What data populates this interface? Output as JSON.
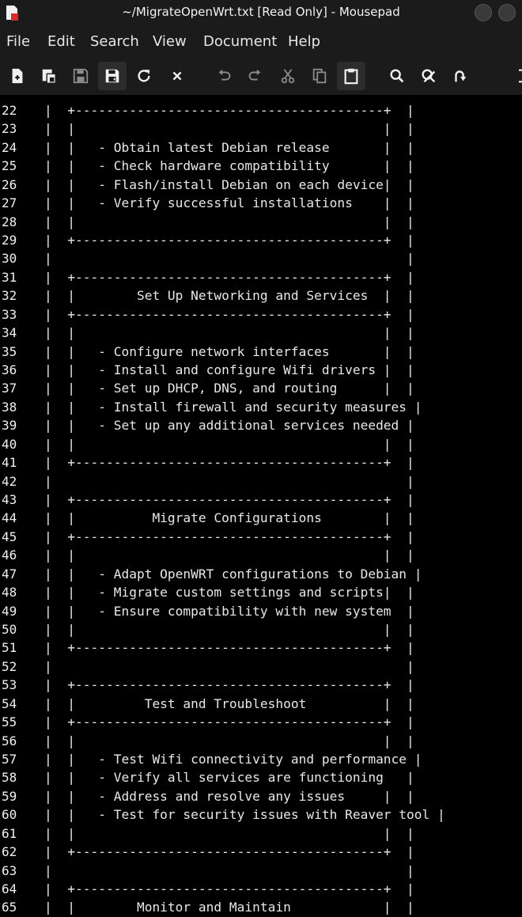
{
  "window": {
    "title": "~/MigrateOpenWrt.txt [Read Only] - Mousepad"
  },
  "menu": [
    {
      "label": "File"
    },
    {
      "label": "Edit"
    },
    {
      "label": "Search"
    },
    {
      "label": "View"
    },
    {
      "label": "Document"
    },
    {
      "label": "Help"
    }
  ],
  "toolbar": [
    {
      "icon": "new-document-icon"
    },
    {
      "icon": "new-window-icon"
    },
    {
      "icon": "save-icon"
    },
    {
      "icon": "save-as-icon"
    },
    {
      "icon": "reload-icon"
    },
    {
      "icon": "close-tab-icon"
    },
    {
      "icon": "undo-icon"
    },
    {
      "icon": "redo-icon"
    },
    {
      "icon": "cut-icon"
    },
    {
      "icon": "copy-icon"
    },
    {
      "icon": "paste-icon"
    },
    {
      "icon": "find-icon"
    },
    {
      "icon": "find-replace-icon"
    },
    {
      "icon": "go-to-line-icon"
    },
    {
      "icon": "fullscreen-icon"
    }
  ],
  "editor": {
    "lines": [
      {
        "num": "22",
        "text": "|  +----------------------------------------+  |"
      },
      {
        "num": "23",
        "text": "|  |                                        |  |"
      },
      {
        "num": "24",
        "text": "|  |   - Obtain latest Debian release       |  |"
      },
      {
        "num": "25",
        "text": "|  |   - Check hardware compatibility       |  |"
      },
      {
        "num": "26",
        "text": "|  |   - Flash/install Debian on each device|  |"
      },
      {
        "num": "27",
        "text": "|  |   - Verify successful installations    |  |"
      },
      {
        "num": "28",
        "text": "|  |                                        |  |"
      },
      {
        "num": "29",
        "text": "|  +----------------------------------------+  |"
      },
      {
        "num": "30",
        "text": "|                                              |"
      },
      {
        "num": "31",
        "text": "|  +----------------------------------------+  |"
      },
      {
        "num": "32",
        "text": "|  |        Set Up Networking and Services  |  |"
      },
      {
        "num": "33",
        "text": "|  +----------------------------------------+  |"
      },
      {
        "num": "34",
        "text": "|  |                                        |  |"
      },
      {
        "num": "35",
        "text": "|  |   - Configure network interfaces       |  |"
      },
      {
        "num": "36",
        "text": "|  |   - Install and configure Wifi drivers |  |"
      },
      {
        "num": "37",
        "text": "|  |   - Set up DHCP, DNS, and routing      |  |"
      },
      {
        "num": "38",
        "text": "|  |   - Install firewall and security measures |"
      },
      {
        "num": "39",
        "text": "|  |   - Set up any additional services needed |"
      },
      {
        "num": "40",
        "text": "|  |                                        |  |"
      },
      {
        "num": "41",
        "text": "|  +----------------------------------------+  |"
      },
      {
        "num": "42",
        "text": "|                                              |"
      },
      {
        "num": "43",
        "text": "|  +----------------------------------------+  |"
      },
      {
        "num": "44",
        "text": "|  |          Migrate Configurations        |  |"
      },
      {
        "num": "45",
        "text": "|  +----------------------------------------+  |"
      },
      {
        "num": "46",
        "text": "|  |                                        |  |"
      },
      {
        "num": "47",
        "text": "|  |   - Adapt OpenWRT configurations to Debian |"
      },
      {
        "num": "48",
        "text": "|  |   - Migrate custom settings and scripts|  |"
      },
      {
        "num": "49",
        "text": "|  |   - Ensure compatibility with new system  |"
      },
      {
        "num": "50",
        "text": "|  |                                        |  |"
      },
      {
        "num": "51",
        "text": "|  +----------------------------------------+  |"
      },
      {
        "num": "52",
        "text": "|                                              |"
      },
      {
        "num": "53",
        "text": "|  +----------------------------------------+  |"
      },
      {
        "num": "54",
        "text": "|  |         Test and Troubleshoot          |  |"
      },
      {
        "num": "55",
        "text": "|  +----------------------------------------+  |"
      },
      {
        "num": "56",
        "text": "|  |                                        |  |"
      },
      {
        "num": "57",
        "text": "|  |   - Test Wifi connectivity and performance |"
      },
      {
        "num": "58",
        "text": "|  |   - Verify all services are functioning   |"
      },
      {
        "num": "59",
        "text": "|  |   - Address and resolve any issues     |  |"
      },
      {
        "num": "60",
        "text": "|  |   - Test for security issues with Reaver tool |"
      },
      {
        "num": "61",
        "text": "|  |                                        |  |"
      },
      {
        "num": "62",
        "text": "|  +----------------------------------------+  |"
      },
      {
        "num": "63",
        "text": "|                                              |"
      },
      {
        "num": "64",
        "text": "|  +----------------------------------------+  |"
      },
      {
        "num": "65",
        "text": "|  |        Monitor and Maintain            |  |"
      }
    ]
  }
}
